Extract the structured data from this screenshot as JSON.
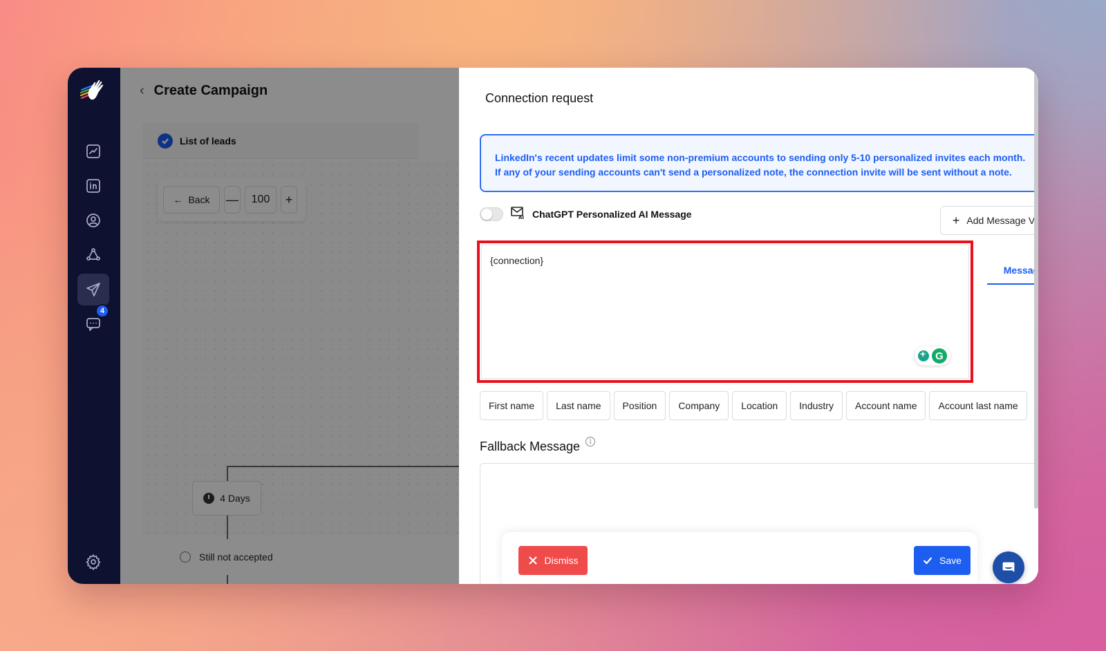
{
  "background_page": {
    "title": "Create Campaign",
    "step_label": "List of leads",
    "back_label": "Back",
    "minus_label": "—",
    "zoom_value": "100",
    "plus_label": "+",
    "delay_label": "4 Days",
    "condition_label": "Still not accepted"
  },
  "sidebar": {
    "messages_badge": "4"
  },
  "modal": {
    "title": "Connection request",
    "notice_line1": "LinkedIn's recent updates limit some non-premium accounts to sending only 5-10 personalized invites each month.",
    "notice_line2": "If any of your sending accounts can't send a personalized note, the connection invite will be sent without a note.",
    "ai_toggle_label": "ChatGPT Personalized AI Message",
    "add_variation_label": "Add Message Variation",
    "message_text": "{connection}",
    "message_tab": "Message A",
    "variables": [
      "First name",
      "Last name",
      "Position",
      "Company",
      "Location",
      "Industry",
      "Account name",
      "Account last name"
    ],
    "fallback_title": "Fallback Message",
    "dismiss_label": "Dismiss",
    "save_label": "Save"
  },
  "colors": {
    "primary": "#1d5ef0",
    "danger": "#ef4b4b",
    "highlight": "#e8101a",
    "sidebar_bg": "#0f1130"
  }
}
